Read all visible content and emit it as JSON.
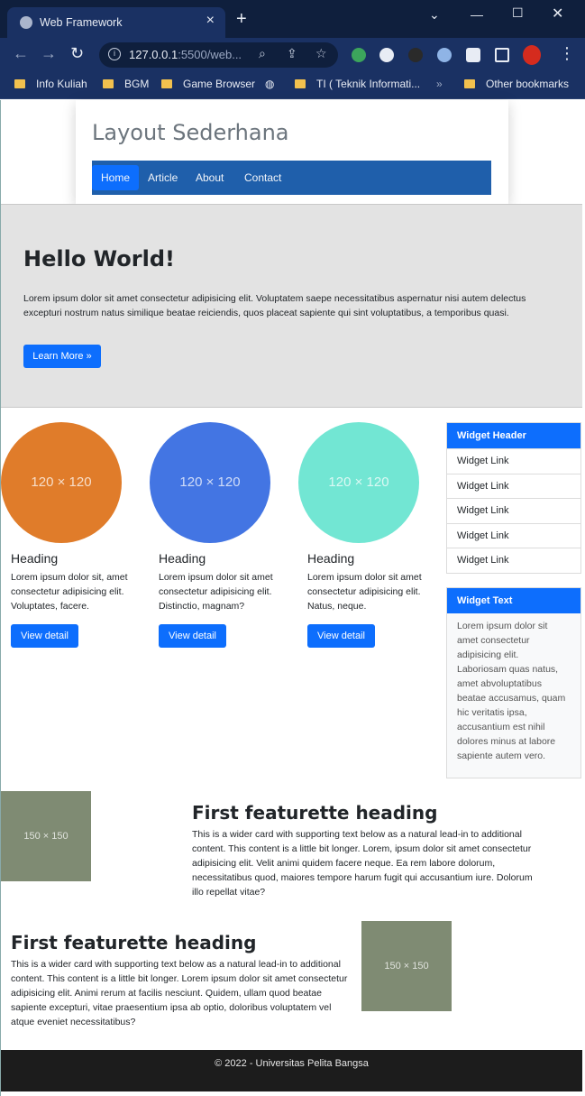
{
  "browser": {
    "tab_title": "Web Framework",
    "url_host": "127.0.0.1",
    "url_rest": ":5500/web...",
    "bookmarks": [
      "Info Kuliah",
      "BGM",
      "Game Browser",
      "TI ( Teknik Informati...",
      "Other bookmarks"
    ],
    "overflow": "»"
  },
  "site": {
    "title": "Layout Sederhana",
    "nav": [
      "Home",
      "Article",
      "About",
      "Contact"
    ]
  },
  "hero": {
    "heading": "Hello World!",
    "text": "Lorem ipsum dolor sit amet consectetur adipisicing elit. Voluptatem saepe necessitatibus aspernatur nisi autem delectus excepturi nostrum natus similique beatae reiciendis, quos placeat sapiente qui sint voluptatibus, a temporibus quasi.",
    "button": "Learn More »"
  },
  "features": [
    {
      "placeholder": "120 × 120",
      "heading": "Heading",
      "text": "Lorem ipsum dolor sit, amet consectetur adipisicing elit. Voluptates, facere.",
      "button": "View detail",
      "color": "#e07c2a"
    },
    {
      "placeholder": "120 × 120",
      "heading": "Heading",
      "text": "Lorem ipsum dolor sit amet consectetur adipisicing elit. Distinctio, magnam?",
      "button": "View detail",
      "color": "#4375e3"
    },
    {
      "placeholder": "120 × 120",
      "heading": "Heading",
      "text": "Lorem ipsum dolor sit amet consectetur adipisicing elit. Natus, neque.",
      "button": "View detail",
      "color": "#72e6d3"
    }
  ],
  "widgets": {
    "links_header": "Widget Header",
    "links": [
      "Widget Link",
      "Widget Link",
      "Widget Link",
      "Widget Link",
      "Widget Link"
    ],
    "text_header": "Widget Text",
    "text": "Lorem ipsum dolor sit amet consectetur adipisicing elit. Laboriosam quas natus, amet abvoluptatibus beatae accusamus, quam hic veritatis ipsa, accusantium est nihil dolores minus at labore sapiente autem vero."
  },
  "featurettes": [
    {
      "placeholder": "150 × 150",
      "heading": "First featurette heading",
      "text": "This is a wider card with supporting text below as a natural lead-in to additional content. This content is a little bit longer. Lorem, ipsum dolor sit amet consectetur adipisicing elit. Velit animi quidem facere neque. Ea rem labore dolorum, necessitatibus quod, maiores tempore harum fugit qui accusantium iure. Dolorum illo repellat vitae?"
    },
    {
      "placeholder": "150 × 150",
      "heading": "First featurette heading",
      "text": "This is a wider card with supporting text below as a natural lead-in to additional content. This content is a little bit longer. Lorem ipsum dolor sit amet consectetur adipisicing elit. Animi rerum at facilis nesciunt. Quidem, ullam quod beatae sapiente excepturi, vitae praesentium ipsa ab optio, doloribus voluptatem vel atque eveniet necessitatibus?"
    }
  ],
  "footer": {
    "text": "© 2022 - Universitas Pelita Bangsa"
  }
}
